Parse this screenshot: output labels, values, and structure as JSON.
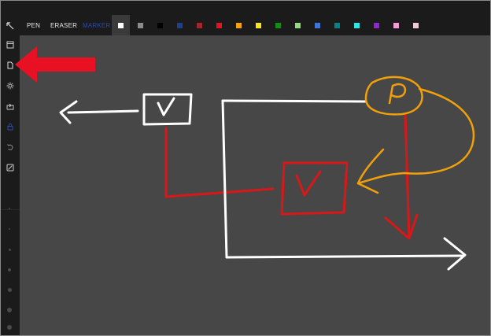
{
  "toolbar": {
    "pen_label": "PEN",
    "eraser_label": "ERASER",
    "marker_label": "MARKER",
    "marker_color": "#2d4aa6",
    "palette": [
      {
        "name": "white",
        "hex": "#ffffff"
      },
      {
        "name": "gray",
        "hex": "#8c8c8c"
      },
      {
        "name": "black",
        "hex": "#000000"
      },
      {
        "name": "navy",
        "hex": "#1f3f8f"
      },
      {
        "name": "dark-red",
        "hex": "#a4262c"
      },
      {
        "name": "red",
        "hex": "#e81123"
      },
      {
        "name": "orange",
        "hex": "#f7a30a"
      },
      {
        "name": "yellow",
        "hex": "#f7e51d"
      },
      {
        "name": "green",
        "hex": "#138c18"
      },
      {
        "name": "light-green",
        "hex": "#8fdd7c"
      },
      {
        "name": "blue",
        "hex": "#3f74d8"
      },
      {
        "name": "teal",
        "hex": "#038387"
      },
      {
        "name": "cyan",
        "hex": "#2ee6e6"
      },
      {
        "name": "purple",
        "hex": "#8e25d6"
      },
      {
        "name": "pink",
        "hex": "#f29bd5"
      },
      {
        "name": "light-pink",
        "hex": "#f7c7d0"
      }
    ]
  },
  "sidebar": {
    "icons": [
      "select-cursor-icon",
      "save-icon",
      "new-page-icon",
      "settings-icon",
      "share-icon",
      "lock-icon",
      "undo-icon",
      "clear-icon"
    ]
  },
  "colors": {
    "background": "#1f1f1f",
    "canvas": "#474747",
    "pointer_arrow": "#e81123",
    "ink_white": "#ffffff",
    "ink_red": "#d81818",
    "ink_orange": "#f0a00a"
  }
}
